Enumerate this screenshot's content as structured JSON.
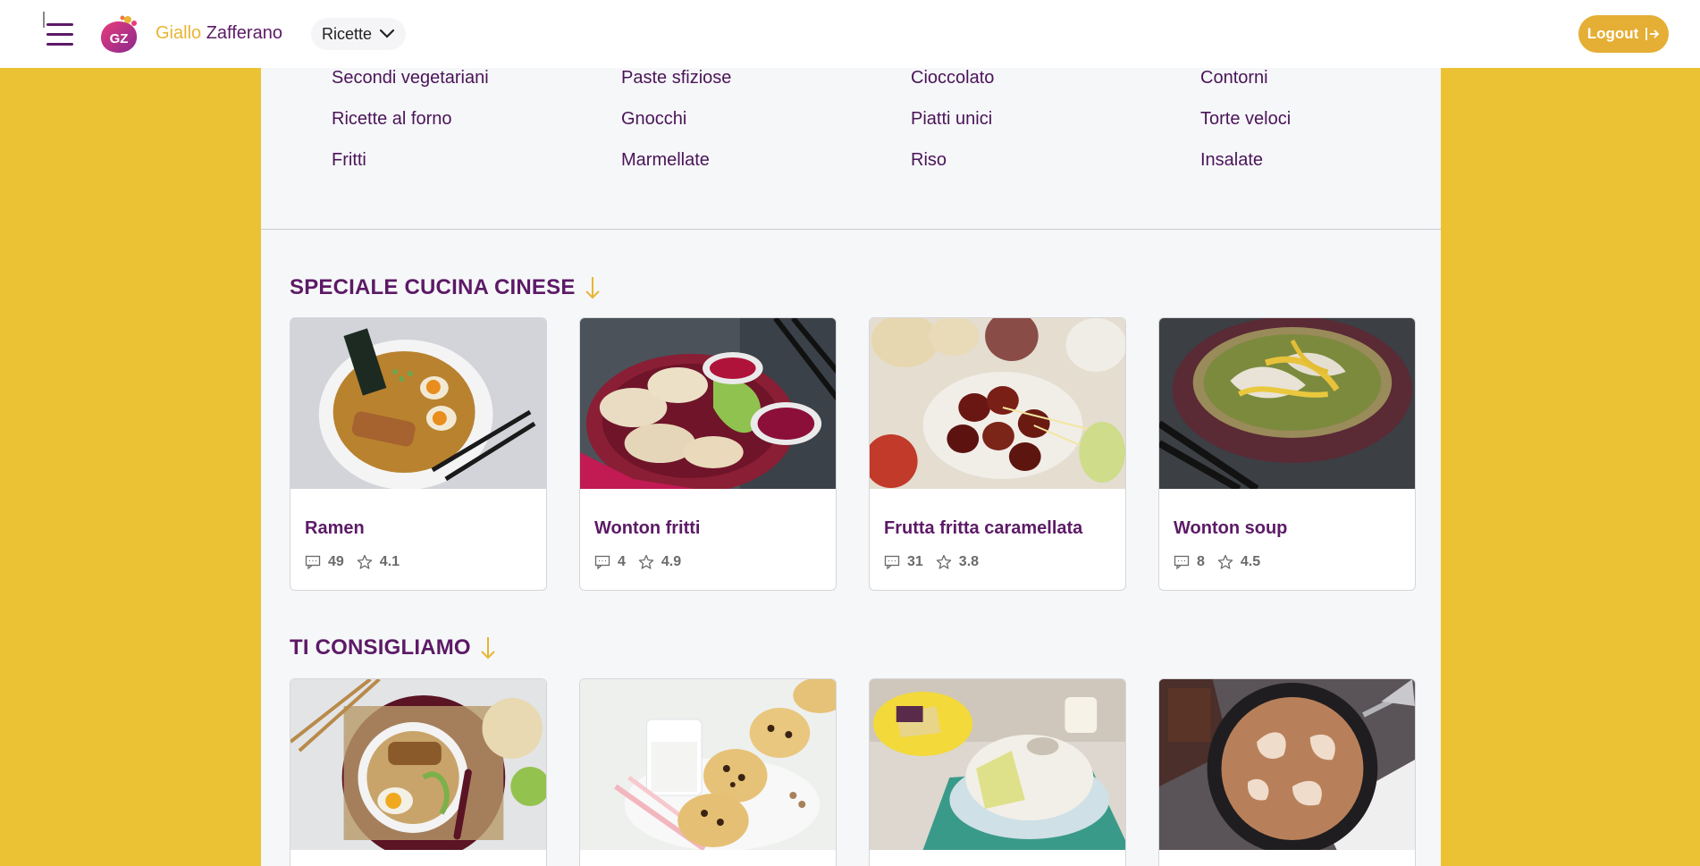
{
  "header": {
    "brand_part1": "Giallo",
    "brand_part2": "Zafferano",
    "logo_text": "GZ",
    "menu_label": "Ricette",
    "logout_label": "Logout"
  },
  "categories": [
    "Secondi vegetariani",
    "Paste sfiziose",
    "Cioccolato",
    "Contorni",
    "Ricette al forno",
    "Gnocchi",
    "Piatti unici",
    "Torte veloci",
    "Fritti",
    "Marmellate",
    "Riso",
    "Insalate"
  ],
  "sections": [
    {
      "title": "SPECIALE CUCINA CINESE",
      "cards": [
        {
          "title": "Ramen",
          "comments": "49",
          "rating": "4.1",
          "image": "ramen-bowl-photo"
        },
        {
          "title": "Wonton fritti",
          "comments": "4",
          "rating": "4.9",
          "image": "fried-wonton-photo"
        },
        {
          "title": "Frutta fritta caramellata",
          "comments": "31",
          "rating": "3.8",
          "image": "caramelized-fruit-photo"
        },
        {
          "title": "Wonton soup",
          "comments": "8",
          "rating": "4.5",
          "image": "wonton-soup-photo"
        }
      ]
    },
    {
      "title": "TI CONSIGLIAMO",
      "cards": [
        {
          "image": "noodle-soup-photo"
        },
        {
          "image": "chocolate-chip-muffins-photo"
        },
        {
          "image": "bundt-cake-photo"
        },
        {
          "image": "chocolate-cake-photo"
        }
      ]
    }
  ],
  "colors": {
    "page_background": "#ecc235",
    "accent_purple": "#5c1a66",
    "logout_button": "#e5ae34",
    "panel_background": "#f6f7f9"
  },
  "icons": [
    "hamburger-menu-icon",
    "chevron-down-icon",
    "logout-arrow-icon",
    "arrow-down-icon",
    "comment-icon",
    "star-icon"
  ]
}
